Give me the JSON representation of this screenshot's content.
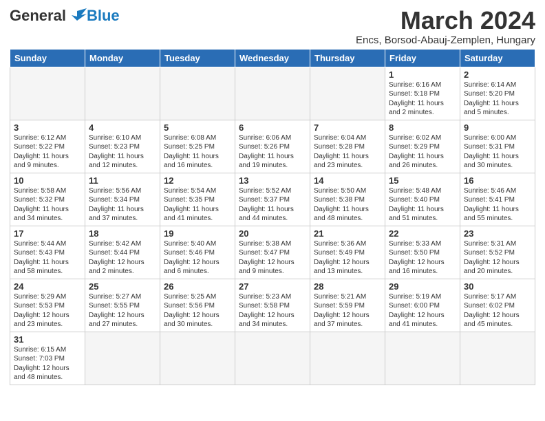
{
  "header": {
    "logo_general": "General",
    "logo_blue": "Blue",
    "month_title": "March 2024",
    "subtitle": "Encs, Borsod-Abauj-Zemplen, Hungary"
  },
  "weekdays": [
    "Sunday",
    "Monday",
    "Tuesday",
    "Wednesday",
    "Thursday",
    "Friday",
    "Saturday"
  ],
  "weeks": [
    [
      {
        "num": "",
        "info": ""
      },
      {
        "num": "",
        "info": ""
      },
      {
        "num": "",
        "info": ""
      },
      {
        "num": "",
        "info": ""
      },
      {
        "num": "",
        "info": ""
      },
      {
        "num": "1",
        "info": "Sunrise: 6:16 AM\nSunset: 5:18 PM\nDaylight: 11 hours\nand 2 minutes."
      },
      {
        "num": "2",
        "info": "Sunrise: 6:14 AM\nSunset: 5:20 PM\nDaylight: 11 hours\nand 5 minutes."
      }
    ],
    [
      {
        "num": "3",
        "info": "Sunrise: 6:12 AM\nSunset: 5:22 PM\nDaylight: 11 hours\nand 9 minutes."
      },
      {
        "num": "4",
        "info": "Sunrise: 6:10 AM\nSunset: 5:23 PM\nDaylight: 11 hours\nand 12 minutes."
      },
      {
        "num": "5",
        "info": "Sunrise: 6:08 AM\nSunset: 5:25 PM\nDaylight: 11 hours\nand 16 minutes."
      },
      {
        "num": "6",
        "info": "Sunrise: 6:06 AM\nSunset: 5:26 PM\nDaylight: 11 hours\nand 19 minutes."
      },
      {
        "num": "7",
        "info": "Sunrise: 6:04 AM\nSunset: 5:28 PM\nDaylight: 11 hours\nand 23 minutes."
      },
      {
        "num": "8",
        "info": "Sunrise: 6:02 AM\nSunset: 5:29 PM\nDaylight: 11 hours\nand 26 minutes."
      },
      {
        "num": "9",
        "info": "Sunrise: 6:00 AM\nSunset: 5:31 PM\nDaylight: 11 hours\nand 30 minutes."
      }
    ],
    [
      {
        "num": "10",
        "info": "Sunrise: 5:58 AM\nSunset: 5:32 PM\nDaylight: 11 hours\nand 34 minutes."
      },
      {
        "num": "11",
        "info": "Sunrise: 5:56 AM\nSunset: 5:34 PM\nDaylight: 11 hours\nand 37 minutes."
      },
      {
        "num": "12",
        "info": "Sunrise: 5:54 AM\nSunset: 5:35 PM\nDaylight: 11 hours\nand 41 minutes."
      },
      {
        "num": "13",
        "info": "Sunrise: 5:52 AM\nSunset: 5:37 PM\nDaylight: 11 hours\nand 44 minutes."
      },
      {
        "num": "14",
        "info": "Sunrise: 5:50 AM\nSunset: 5:38 PM\nDaylight: 11 hours\nand 48 minutes."
      },
      {
        "num": "15",
        "info": "Sunrise: 5:48 AM\nSunset: 5:40 PM\nDaylight: 11 hours\nand 51 minutes."
      },
      {
        "num": "16",
        "info": "Sunrise: 5:46 AM\nSunset: 5:41 PM\nDaylight: 11 hours\nand 55 minutes."
      }
    ],
    [
      {
        "num": "17",
        "info": "Sunrise: 5:44 AM\nSunset: 5:43 PM\nDaylight: 11 hours\nand 58 minutes."
      },
      {
        "num": "18",
        "info": "Sunrise: 5:42 AM\nSunset: 5:44 PM\nDaylight: 12 hours\nand 2 minutes."
      },
      {
        "num": "19",
        "info": "Sunrise: 5:40 AM\nSunset: 5:46 PM\nDaylight: 12 hours\nand 6 minutes."
      },
      {
        "num": "20",
        "info": "Sunrise: 5:38 AM\nSunset: 5:47 PM\nDaylight: 12 hours\nand 9 minutes."
      },
      {
        "num": "21",
        "info": "Sunrise: 5:36 AM\nSunset: 5:49 PM\nDaylight: 12 hours\nand 13 minutes."
      },
      {
        "num": "22",
        "info": "Sunrise: 5:33 AM\nSunset: 5:50 PM\nDaylight: 12 hours\nand 16 minutes."
      },
      {
        "num": "23",
        "info": "Sunrise: 5:31 AM\nSunset: 5:52 PM\nDaylight: 12 hours\nand 20 minutes."
      }
    ],
    [
      {
        "num": "24",
        "info": "Sunrise: 5:29 AM\nSunset: 5:53 PM\nDaylight: 12 hours\nand 23 minutes."
      },
      {
        "num": "25",
        "info": "Sunrise: 5:27 AM\nSunset: 5:55 PM\nDaylight: 12 hours\nand 27 minutes."
      },
      {
        "num": "26",
        "info": "Sunrise: 5:25 AM\nSunset: 5:56 PM\nDaylight: 12 hours\nand 30 minutes."
      },
      {
        "num": "27",
        "info": "Sunrise: 5:23 AM\nSunset: 5:58 PM\nDaylight: 12 hours\nand 34 minutes."
      },
      {
        "num": "28",
        "info": "Sunrise: 5:21 AM\nSunset: 5:59 PM\nDaylight: 12 hours\nand 37 minutes."
      },
      {
        "num": "29",
        "info": "Sunrise: 5:19 AM\nSunset: 6:00 PM\nDaylight: 12 hours\nand 41 minutes."
      },
      {
        "num": "30",
        "info": "Sunrise: 5:17 AM\nSunset: 6:02 PM\nDaylight: 12 hours\nand 45 minutes."
      }
    ],
    [
      {
        "num": "31",
        "info": "Sunrise: 6:15 AM\nSunset: 7:03 PM\nDaylight: 12 hours\nand 48 minutes."
      },
      {
        "num": "",
        "info": ""
      },
      {
        "num": "",
        "info": ""
      },
      {
        "num": "",
        "info": ""
      },
      {
        "num": "",
        "info": ""
      },
      {
        "num": "",
        "info": ""
      },
      {
        "num": "",
        "info": ""
      }
    ]
  ]
}
